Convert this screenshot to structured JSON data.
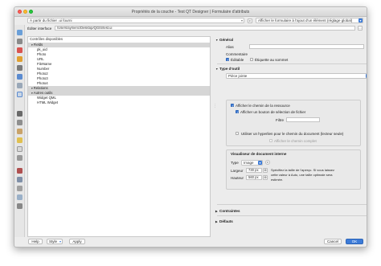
{
  "window": {
    "title": "Propriétés de la couche - Test QT Designer | Formulaire d'attributs"
  },
  "top": {
    "layout_select": "À partir du fichier .ui fourni",
    "show_form_select": "Afficher le formulaire à l'ajout d'un élément (réglage global)"
  },
  "edit_interface": {
    "label": "Éditer interface",
    "path": "/Users/aymeric/Desktop/QGIS/test.ui",
    "browse_label": "…"
  },
  "tree": {
    "header": "Contrôles disponibles",
    "items": [
      {
        "label": "Fields",
        "indent": 1,
        "group": true
      },
      {
        "label": "pk_uid",
        "indent": 2,
        "group": false
      },
      {
        "label": "Photo",
        "indent": 2,
        "group": false
      },
      {
        "label": "URL",
        "indent": 2,
        "group": false
      },
      {
        "label": "FileName",
        "indent": 2,
        "group": false
      },
      {
        "label": "Number",
        "indent": 2,
        "group": false
      },
      {
        "label": "Photo2",
        "indent": 2,
        "group": false
      },
      {
        "label": "Photo3",
        "indent": 2,
        "group": false
      },
      {
        "label": "Photo4",
        "indent": 2,
        "group": false
      },
      {
        "label": "Relations",
        "indent": 1,
        "group": true
      },
      {
        "label": "Autres outils",
        "indent": 1,
        "group": true
      },
      {
        "label": "Widget QML",
        "indent": 2,
        "group": false
      },
      {
        "label": "HTML Widget",
        "indent": 2,
        "group": false
      }
    ]
  },
  "general": {
    "title": "Général",
    "alias_label": "Alias",
    "comment_label": "Commentaire",
    "editable_label": "Éditable",
    "label_on_top_label": "Étiquette au sommet"
  },
  "widget_type": {
    "title": "Type d'outil",
    "selected": "Pièce jointe"
  },
  "attachment": {
    "show_path_label": "Afficher le chemin de la ressource",
    "show_button_label": "Afficher un bouton de sélection de fichier",
    "filter_label": "Filtre",
    "filter_value": "",
    "hyperlink_label": "Utiliser un hyperlien pour le chemin du document (lecteur seule)",
    "full_path_label": "Afficher le chemin complet"
  },
  "viewer": {
    "title": "Visualiseur de document interne",
    "type_label": "Type",
    "type_value": "Image",
    "width_label": "Largeur",
    "width_value": "730",
    "height_label": "Hauteur",
    "height_value": "560",
    "unit": "px",
    "help_text_1": "Spécifiez la taille de l'aperçu. Si vous laissez",
    "help_text_2": "cette valeur à Auto, une taille optimale sera",
    "help_text_3": "estimée."
  },
  "constraints": {
    "title": "Contraintes"
  },
  "defaults": {
    "title": "Défauts"
  },
  "footer": {
    "help_label": "Help",
    "style_label": "Style",
    "apply_label": "Apply",
    "cancel_label": "Cancel",
    "ok_label": "OK"
  },
  "colors": {
    "accent": "#3c7bd8",
    "group_row": "#d6d6d6"
  }
}
